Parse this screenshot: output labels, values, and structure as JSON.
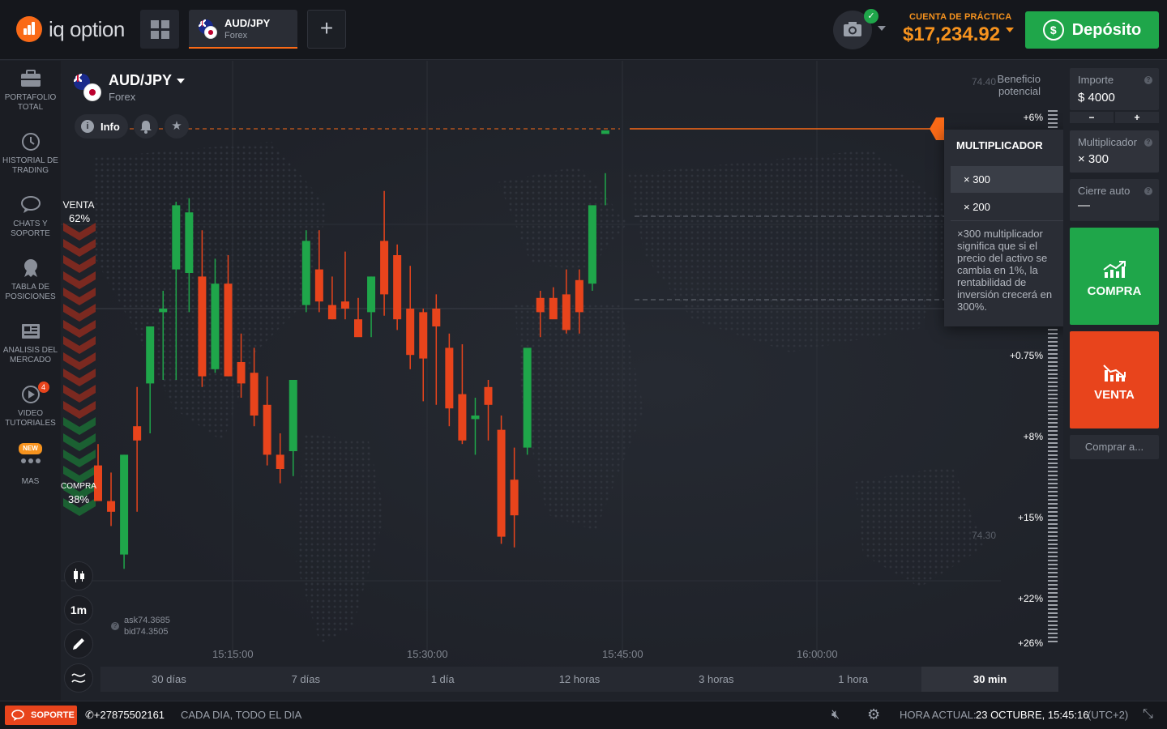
{
  "logo": {
    "text": "iq option"
  },
  "tab": {
    "pair": "AUD/JPY",
    "category": "Forex"
  },
  "add_tab": "+",
  "account": {
    "label": "CUENTA DE PRÁCTICA",
    "balance": "$17,234.92"
  },
  "deposit": {
    "label": "Depósito"
  },
  "sidebar": [
    {
      "label": "PORTAFOLIO TOTAL",
      "icon": "briefcase-icon"
    },
    {
      "label": "HISTORIAL DE TRADING",
      "icon": "history-icon"
    },
    {
      "label": "CHATS Y SOPORTE",
      "icon": "chat-icon"
    },
    {
      "label": "TABLA DE POSICIONES",
      "icon": "trophy-icon"
    },
    {
      "label": "ANALISIS DEL MERCADO",
      "icon": "news-icon"
    },
    {
      "label": "VIDEO TUTORIALES",
      "icon": "play-icon",
      "badge": "4"
    },
    {
      "label": "MAS",
      "icon": "more-icon",
      "badge": "NEW"
    }
  ],
  "asset": {
    "name": "AUD/JPY",
    "category": "Forex",
    "info_label": "Info"
  },
  "sentiment": {
    "sell_label": "VENTA",
    "sell_pct": "62%",
    "buy_label": "COMPRA",
    "buy_pct": "38%"
  },
  "tools": {
    "candles": "candles-icon",
    "interval": "1m",
    "draw": "pencil-icon",
    "indicators": "indicators-icon"
  },
  "quote": {
    "ask": "ask74.3685",
    "bid": "bid74.3505"
  },
  "benefit": {
    "line1": "Beneficio",
    "line2": "potencial"
  },
  "price_axis": [
    "74.40",
    "74.30"
  ],
  "pct_axis": [
    "+6%",
    "+0.75%",
    "+8%",
    "+15%",
    "+22%",
    "+26%"
  ],
  "time_axis": [
    "15:15:00",
    "15:30:00",
    "15:45:00",
    "16:00:00"
  ],
  "timeframes": [
    "30 días",
    "7 días",
    "1 día",
    "12 horas",
    "3 horas",
    "1 hora",
    "30 min"
  ],
  "timeframe_selected": "30 min",
  "multiplier_popup": {
    "title": "MULTIPLICADOR",
    "options": [
      "× 300",
      "× 200"
    ],
    "selected": "× 300",
    "description": "×300 multiplicador significa que si el precio del activo se cambia en 1%, la rentabilidad de inversión crecerá en 300%."
  },
  "panel": {
    "amount_label": "Importe",
    "amount_value": "$  4000",
    "minus": "−",
    "plus": "+",
    "mult_label": "Multiplicador",
    "mult_value": "× 300",
    "auto_label": "Cierre auto",
    "auto_value": "—",
    "buy_label": "COMPRA",
    "sell_label": "VENTA",
    "buy_at_label": "Comprar a..."
  },
  "footer": {
    "support_label": "SOPORTE",
    "phone": "+27875502161",
    "hours": "CADA DIA, TODO EL DIA",
    "time_label": "HORA ACTUAL:",
    "time_value": "23 OCTUBRE, 15:45:16",
    "tz": "(UTC+2)"
  },
  "colors": {
    "up": "#1fa64a",
    "down": "#e8441c",
    "accent": "#fa6a17"
  },
  "chart_data": {
    "type": "candlestick",
    "x": [
      "15:06",
      "15:07",
      "15:08",
      "15:09",
      "15:10",
      "15:11",
      "15:12",
      "15:13",
      "15:14",
      "15:15",
      "15:16",
      "15:17",
      "15:18",
      "15:19",
      "15:20",
      "15:21",
      "15:22",
      "15:23",
      "15:24",
      "15:25",
      "15:26",
      "15:27",
      "15:28",
      "15:29",
      "15:30",
      "15:31",
      "15:32",
      "15:33",
      "15:34",
      "15:35",
      "15:36",
      "15:37",
      "15:38",
      "15:39",
      "15:40",
      "15:41",
      "15:42",
      "15:43",
      "15:44",
      "15:45"
    ],
    "candles": [
      [
        74.331,
        74.337,
        74.322,
        74.321
      ],
      [
        74.321,
        74.329,
        74.314,
        74.318
      ],
      [
        74.306,
        74.334,
        74.302,
        74.334
      ],
      [
        74.342,
        74.353,
        74.318,
        74.338
      ],
      [
        74.354,
        74.37,
        74.34,
        74.37
      ],
      [
        74.374,
        74.38,
        74.355,
        74.375
      ],
      [
        74.386,
        74.405,
        74.355,
        74.404
      ],
      [
        74.385,
        74.406,
        74.374,
        74.402
      ],
      [
        74.384,
        74.397,
        74.353,
        74.356
      ],
      [
        74.358,
        74.389,
        74.357,
        74.382
      ],
      [
        74.382,
        74.39,
        74.356,
        74.356
      ],
      [
        74.36,
        74.368,
        74.35,
        74.354
      ],
      [
        74.357,
        74.364,
        74.342,
        74.345
      ],
      [
        74.348,
        74.356,
        74.331,
        74.334
      ],
      [
        74.334,
        74.34,
        74.326,
        74.33
      ],
      [
        74.335,
        74.355,
        74.328,
        74.355
      ],
      [
        74.376,
        74.397,
        74.374,
        74.394
      ],
      [
        74.386,
        74.397,
        74.374,
        74.377
      ],
      [
        74.376,
        74.384,
        74.372,
        74.372
      ],
      [
        74.377,
        74.391,
        74.372,
        74.375
      ],
      [
        74.372,
        74.378,
        74.368,
        74.367
      ],
      [
        74.374,
        74.384,
        74.367,
        74.384
      ],
      [
        74.394,
        74.408,
        74.373,
        74.379
      ],
      [
        74.39,
        74.393,
        74.369,
        74.372
      ],
      [
        74.375,
        74.387,
        74.358,
        74.362
      ],
      [
        74.374,
        74.375,
        74.349,
        74.361
      ],
      [
        74.375,
        74.379,
        74.348,
        74.37
      ],
      [
        74.364,
        74.368,
        74.342,
        74.347
      ],
      [
        74.351,
        74.365,
        74.337,
        74.338
      ],
      [
        74.344,
        74.35,
        74.334,
        74.345
      ],
      [
        74.353,
        74.355,
        74.338,
        74.348
      ],
      [
        74.341,
        74.345,
        74.309,
        74.311
      ],
      [
        74.327,
        74.336,
        74.308,
        74.317
      ],
      [
        74.336,
        74.355,
        74.334,
        74.364
      ],
      [
        74.378,
        74.38,
        74.367,
        74.374
      ],
      [
        74.378,
        74.381,
        74.374,
        74.372
      ],
      [
        74.379,
        74.386,
        74.368,
        74.369
      ],
      [
        74.383,
        74.386,
        74.368,
        74.374
      ],
      [
        74.382,
        74.396,
        74.38,
        74.404
      ],
      [
        74.424,
        74.413,
        74.404,
        74.425
      ]
    ],
    "price_range": [
      74.29,
      74.44
    ],
    "current_price": 74.425
  }
}
